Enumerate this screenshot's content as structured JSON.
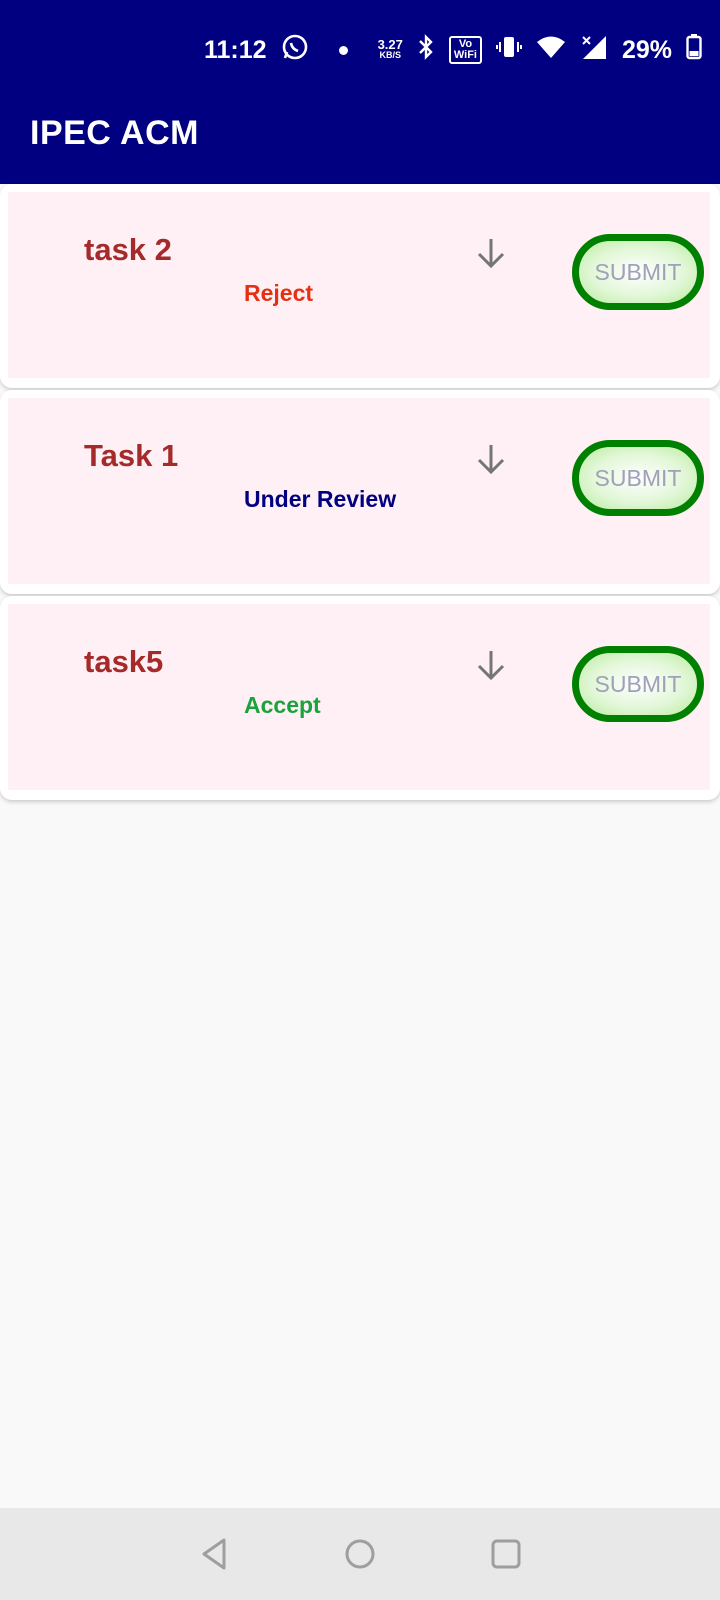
{
  "status_bar": {
    "time": "11:12",
    "net_speed_value": "3.27",
    "net_speed_unit": "KB/S",
    "volte_label_top": "Vo",
    "volte_label_bottom": "WiFi",
    "battery": "29%",
    "icons": [
      "whatsapp-icon",
      "dot-icon",
      "bluetooth-icon",
      "volte-wifi-icon",
      "vibrate-icon",
      "wifi-icon",
      "signal-icon",
      "battery-icon"
    ]
  },
  "app_bar": {
    "title": "IPEC ACM"
  },
  "tasks": [
    {
      "name": "task 2",
      "status": "Reject",
      "status_color": "#e53012",
      "submit_label": "SUBMIT"
    },
    {
      "name": "Task 1",
      "status": "Under Review",
      "status_color": "#000080",
      "submit_label": "SUBMIT"
    },
    {
      "name": "task5",
      "status": "Accept",
      "status_color": "#1aa33a",
      "submit_label": "SUBMIT"
    }
  ],
  "colors": {
    "app_bar": "#000080",
    "task_name": "#a52a2a",
    "submit_border": "#008000",
    "card_fill": "#fff0f5"
  }
}
